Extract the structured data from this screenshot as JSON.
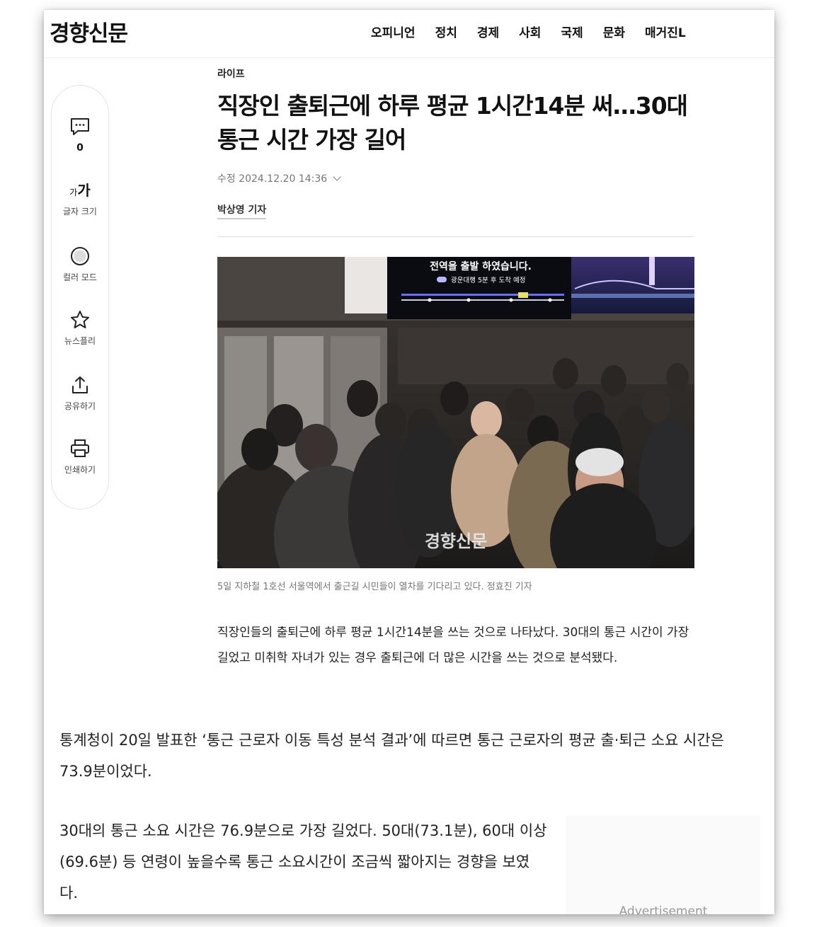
{
  "site": {
    "logo": "경향신문"
  },
  "nav": [
    "오피니언",
    "정치",
    "경제",
    "사회",
    "국제",
    "문화",
    "매거진L"
  ],
  "toolbar": {
    "comment_count": "0",
    "font_size_glyph_small": "가",
    "font_size_glyph_large": "가",
    "font_size_label": "글자 크기",
    "color_mode_label": "컬러 모드",
    "newsfolly_label": "뉴스플리",
    "share_label": "공유하기",
    "print_label": "인쇄하기"
  },
  "article": {
    "section": "라이프",
    "headline": "직장인 출퇴근에 하루 평균 1시간14분 써…30대 통근 시간 가장 길어",
    "date": "수정 2024.12.20 14:36",
    "byline": "박상영 기자",
    "photo": {
      "screen_title": "전역을 출발 하였습니다.",
      "screen_sub": "광운대행 5분 후 도착 예정",
      "watermark": "경향신문"
    },
    "caption": "5일 지하철 1호선 서울역에서 출근길 시민들이 열차를 기다리고 있다. 정효진 기자",
    "lead": "직장인들의 출퇴근에 하루 평균 1시간14분을 쓰는 것으로 나타났다. 30대의 통근 시간이 가장 길었고 미취학 자녀가 있는 경우 출퇴근에 더 많은 시간을 쓰는 것으로 분석됐다.",
    "paragraph1": "통계청이 20일 발표한 ‘통근 근로자 이동 특성 분석 결과’에 따르면 통근 근로자의 평균 출·퇴근 소요 시간은 73.9분이었다.",
    "paragraph2": "30대의 통근 소요 시간은 76.9분으로 가장 길었다. 50대(73.1분), 60대 이상(69.6분) 등 연령이 높을수록 통근 소요시간이 조금씩 짧아지는 경향을 보였다."
  },
  "ad": {
    "label": "Advertisement"
  }
}
